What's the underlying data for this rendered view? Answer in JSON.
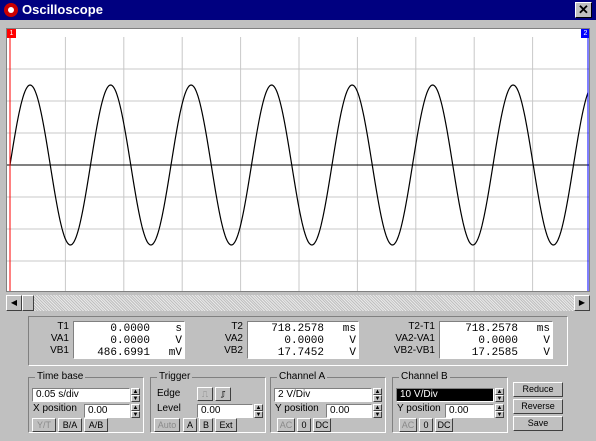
{
  "window": {
    "title": "Oscilloscope",
    "close_glyph": "✕"
  },
  "cursors": {
    "t1_marker": "1",
    "t2_marker": "2",
    "t1_color": "#ff0000",
    "t2_color": "#0000ff"
  },
  "readout": {
    "t1": {
      "label": "T1",
      "rows": [
        {
          "label": "T1",
          "value": "0.0000",
          "unit": "s"
        },
        {
          "label": "VA1",
          "value": "0.0000",
          "unit": "V"
        },
        {
          "label": "VB1",
          "value": "486.6991",
          "unit": "mV"
        }
      ]
    },
    "t2": {
      "rows": [
        {
          "label": "T2",
          "value": "718.2578",
          "unit": "ms"
        },
        {
          "label": "VA2",
          "value": "0.0000",
          "unit": "V"
        },
        {
          "label": "VB2",
          "value": "17.7452",
          "unit": "V"
        }
      ]
    },
    "diff": {
      "rows": [
        {
          "label": "T2-T1",
          "value": "718.2578",
          "unit": "ms"
        },
        {
          "label": "VA2-VA1",
          "value": "0.0000",
          "unit": "V"
        },
        {
          "label": "VB2-VB1",
          "value": "17.2585",
          "unit": "V"
        }
      ]
    }
  },
  "timebase": {
    "title": "Time base",
    "scale": "0.05 s/div",
    "xpos_label": "X position",
    "xpos": "0.00",
    "buttons": [
      "Y/T",
      "B/A",
      "A/B"
    ]
  },
  "trigger": {
    "title": "Trigger",
    "edge_label": "Edge",
    "level_label": "Level",
    "level": "0.00",
    "buttons": [
      "Auto",
      "A",
      "B",
      "Ext"
    ]
  },
  "channel_a": {
    "title": "Channel A",
    "scale": "2 V/Div",
    "ypos_label": "Y position",
    "ypos": "0.00",
    "buttons": [
      "AC",
      "0",
      "DC"
    ]
  },
  "channel_b": {
    "title": "Channel B",
    "scale": "10 V/Div",
    "ypos_label": "Y position",
    "ypos": "0.00",
    "buttons": [
      "AC",
      "0",
      "DC"
    ]
  },
  "actions": {
    "reduce": "Reduce",
    "reverse": "Reverse",
    "save": "Save"
  },
  "signal": {
    "periods_visible": 7.18,
    "amplitude_divs": 1.0,
    "trace_color": "#000000",
    "grid_color": "#c8c8c8",
    "screen_color": "#ffffff"
  }
}
